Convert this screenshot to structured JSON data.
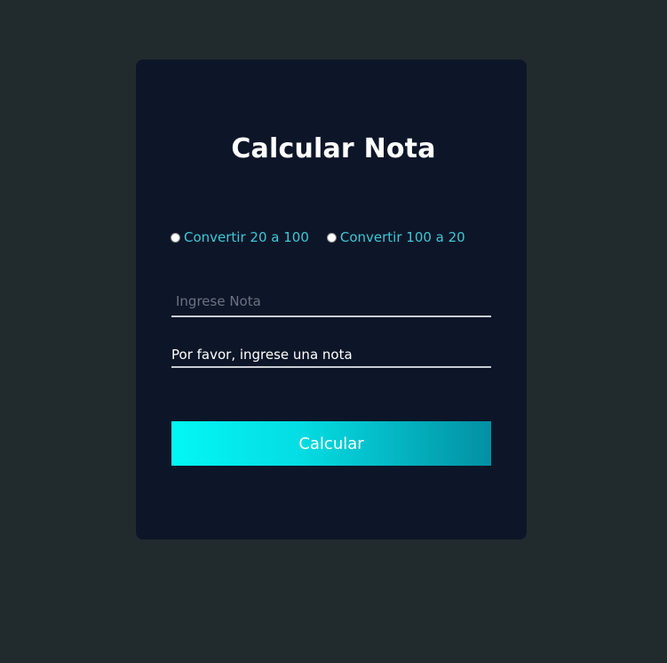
{
  "form": {
    "title": "Calcular Nota",
    "radios": [
      {
        "label": "Convertir 20 a 100",
        "checked": false
      },
      {
        "label": "Convertir 100 a 20",
        "checked": false
      }
    ],
    "grade_input": {
      "placeholder": "Ingrese Nota",
      "value": ""
    },
    "message": "Por favor, ingrese una nota",
    "submit_label": "Calcular"
  },
  "colors": {
    "page_background": "#212b2e",
    "card_background": "#0d1628",
    "radio_label": "#3fc7d6",
    "button_gradient_start": "#03f7f5",
    "button_gradient_end": "#0390a3"
  }
}
